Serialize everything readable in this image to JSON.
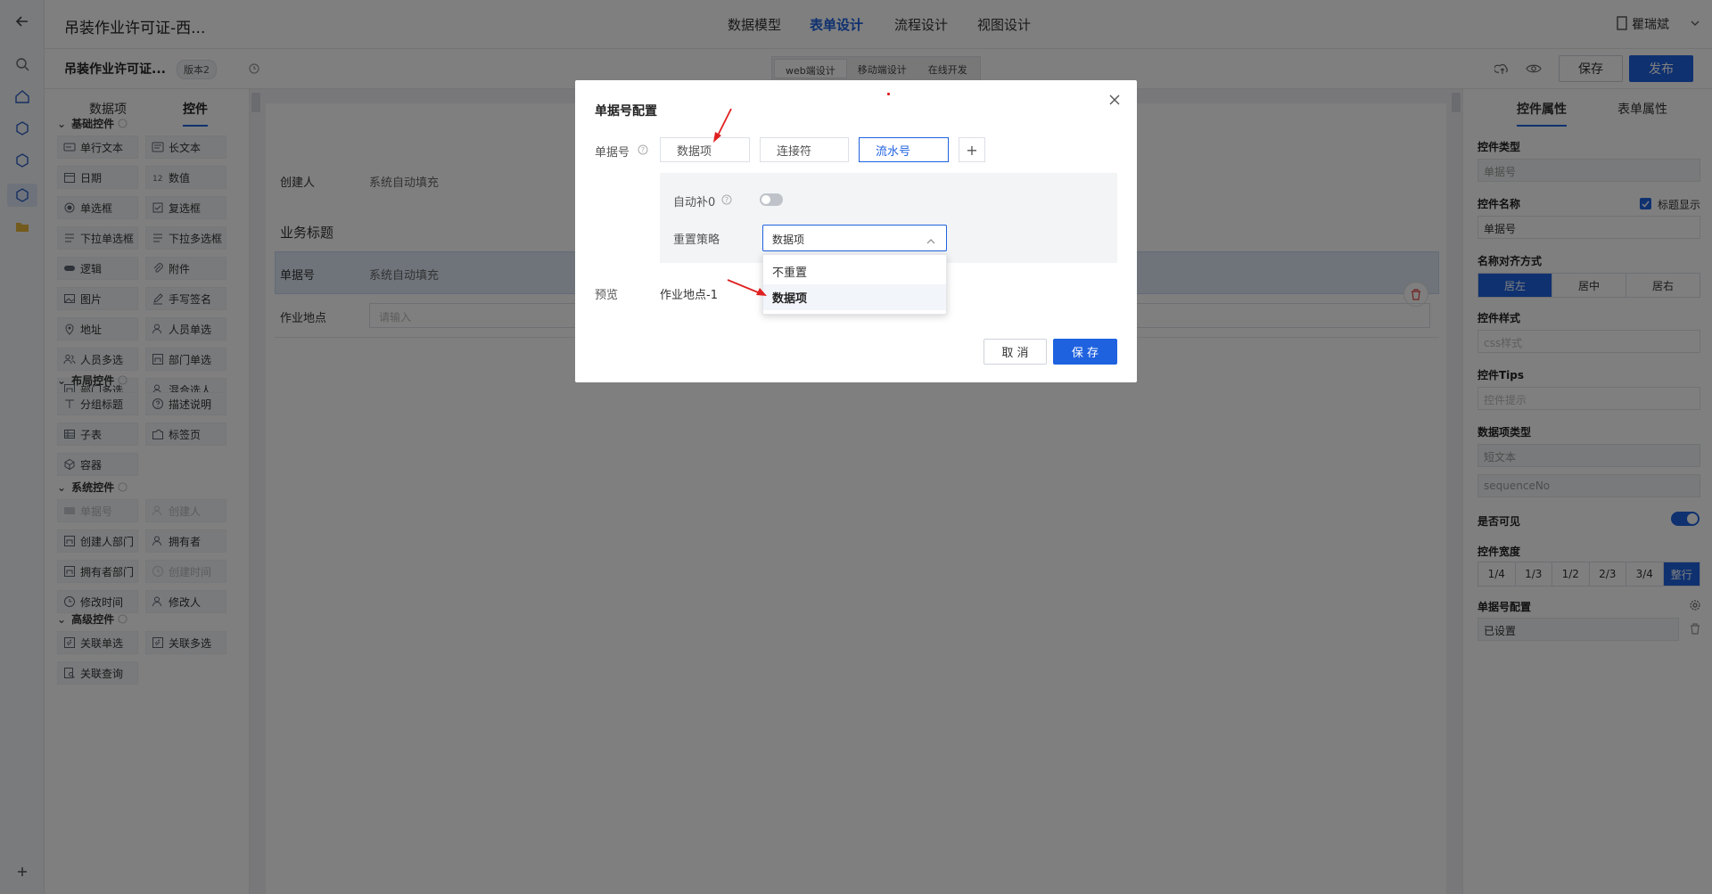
{
  "topbar": {
    "app_title": "吊装作业许可证-西...",
    "tabs": [
      "数据模型",
      "表单设计",
      "流程设计",
      "视图设计"
    ],
    "user_name": "瞿瑞斌"
  },
  "toolbar": {
    "form_name": "吊装作业许可证...",
    "version": "版本2",
    "design_modes": [
      "web端设计",
      "移动端设计",
      "在线开发"
    ],
    "save_label": "保存",
    "publish_label": "发布"
  },
  "left_panel": {
    "tabs": [
      "数据项",
      "控件"
    ],
    "sections": [
      {
        "title": "基础控件",
        "items": [
          {
            "label": "单行文本",
            "icon": "text-line-icon"
          },
          {
            "label": "长文本",
            "icon": "text-long-icon"
          },
          {
            "label": "日期",
            "icon": "calendar-icon"
          },
          {
            "label": "数值",
            "icon": "number-icon"
          },
          {
            "label": "单选框",
            "icon": "radio-icon"
          },
          {
            "label": "复选框",
            "icon": "checkbox-icon"
          },
          {
            "label": "下拉单选框",
            "icon": "list-icon"
          },
          {
            "label": "下拉多选框",
            "icon": "list-icon"
          },
          {
            "label": "逻辑",
            "icon": "toggle-icon"
          },
          {
            "label": "附件",
            "icon": "paperclip-icon"
          },
          {
            "label": "图片",
            "icon": "image-icon"
          },
          {
            "label": "手写签名",
            "icon": "pen-icon"
          },
          {
            "label": "地址",
            "icon": "location-icon"
          },
          {
            "label": "人员单选",
            "icon": "person-icon"
          },
          {
            "label": "人员多选",
            "icon": "people-icon"
          },
          {
            "label": "部门单选",
            "icon": "dept-icon"
          },
          {
            "label": "部门多选",
            "icon": "dept-icon"
          },
          {
            "label": "混合选人",
            "icon": "person-icon"
          }
        ]
      },
      {
        "title": "布局控件",
        "items": [
          {
            "label": "分组标题",
            "icon": "title-icon"
          },
          {
            "label": "描述说明",
            "icon": "help-icon"
          },
          {
            "label": "子表",
            "icon": "table-icon"
          },
          {
            "label": "标签页",
            "icon": "tabs-icon"
          },
          {
            "label": "容器",
            "icon": "cube-icon"
          }
        ]
      },
      {
        "title": "系统控件",
        "items": [
          {
            "label": "单据号",
            "icon": "barcode-icon",
            "disabled": true
          },
          {
            "label": "创建人",
            "icon": "person-icon",
            "disabled": true
          },
          {
            "label": "创建人部门",
            "icon": "dept-icon"
          },
          {
            "label": "拥有者",
            "icon": "person-icon"
          },
          {
            "label": "拥有者部门",
            "icon": "dept-icon"
          },
          {
            "label": "创建时间",
            "icon": "clock-icon",
            "disabled": true
          },
          {
            "label": "修改时间",
            "icon": "clock-icon"
          },
          {
            "label": "修改人",
            "icon": "person-icon"
          }
        ]
      },
      {
        "title": "高级控件",
        "items": [
          {
            "label": "关联单选",
            "icon": "link-icon"
          },
          {
            "label": "关联多选",
            "icon": "link-icon"
          },
          {
            "label": "关联查询",
            "icon": "search-doc-icon"
          }
        ]
      }
    ]
  },
  "form": {
    "creator_label": "创建人",
    "creator_value": "系统自动填充",
    "biz_title": "业务标题",
    "doc_no_label": "单据号",
    "doc_no_value": "系统自动填充",
    "site_label": "作业地点",
    "site_placeholder": "请输入"
  },
  "right_panel": {
    "tabs": [
      "控件属性",
      "表单属性"
    ],
    "control_type_label": "控件类型",
    "control_type_value": "单据号",
    "control_name_label": "控件名称",
    "title_show_label": "标题显示",
    "control_name_value": "单据号",
    "align_label": "名称对齐方式",
    "align_options": [
      "居左",
      "居中",
      "居右"
    ],
    "style_label": "控件样式",
    "style_placeholder": "css样式",
    "tips_label": "控件Tips",
    "tips_placeholder": "控件提示",
    "data_type_label": "数据项类型",
    "data_type_value": "短文本",
    "data_code": "sequenceNo",
    "visible_label": "是否可见",
    "width_label": "控件宽度",
    "width_options": [
      "1/4",
      "1/3",
      "1/2",
      "2/3",
      "3/4",
      "整行"
    ],
    "docno_config_label": "单据号配置",
    "docno_config_value": "已设置"
  },
  "modal": {
    "title": "单据号配置",
    "field_label": "单据号",
    "chips": [
      "数据项",
      "连接符",
      "流水号"
    ],
    "add_label": "+",
    "zero_pad_label": "自动补0",
    "reset_label": "重置策略",
    "reset_value": "数据项",
    "dropdown_options": [
      "不重置",
      "数据项"
    ],
    "preview_label": "预览",
    "preview_value": "作业地点-1",
    "cancel_label": "取 消",
    "save_label": "保 存"
  },
  "colors": {
    "primary": "#1f62e0",
    "annotation_arrow": "#e02020"
  }
}
